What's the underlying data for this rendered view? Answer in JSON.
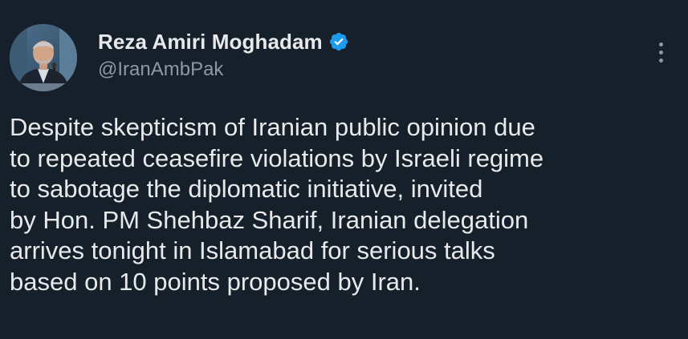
{
  "author": {
    "display_name": "Reza Amiri Moghadam",
    "handle": "@IranAmbPak",
    "verified": true,
    "avatar_icon": "profile-photo",
    "verified_icon": "verified-badge-icon",
    "verified_color": "#1d9bf0"
  },
  "menu": {
    "icon": "more-options-icon"
  },
  "tweet": {
    "lines": [
      "Despite skepticism of Iranian public opinion due",
      "to repeated ceasefire violations by Israeli regime",
      "to sabotage the diplomatic initiative, invited",
      "by Hon. PM Shehbaz Sharif, Iranian delegation",
      "arrives tonight in Islamabad for serious talks",
      "based on 10 points proposed by Iran."
    ]
  },
  "colors": {
    "background": "#15202b",
    "text_primary": "#e7e9ea",
    "text_secondary": "#8b98a5"
  }
}
